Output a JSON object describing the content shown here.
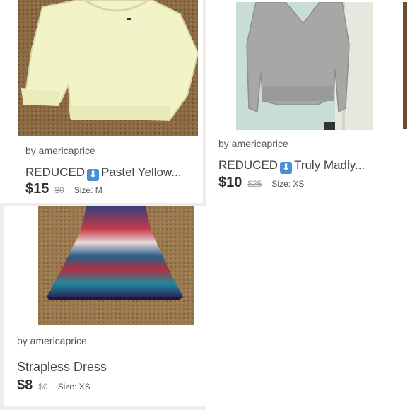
{
  "items": [
    {
      "seller": "by americaprice",
      "title_prefix": "REDUCED",
      "badge_icon": "down-arrow-icon",
      "title_rest": "Pastel Yellow...",
      "price": "$15",
      "original_price": "$0",
      "size": "Size: M"
    },
    {
      "seller": "by americaprice",
      "title_prefix": "REDUCED",
      "badge_icon": "down-arrow-icon",
      "title_rest": "Truly Madly...",
      "price": "$10",
      "original_price": "$25",
      "size": "Size: XS"
    },
    {
      "seller": "by americaprice",
      "title": "Strapless Dress",
      "price": "$8",
      "original_price": "$0",
      "size": "Size: XS"
    }
  ],
  "colors": {
    "badge": "#4a90d9",
    "background": "#ffffff",
    "divider": "#f0ede8"
  }
}
